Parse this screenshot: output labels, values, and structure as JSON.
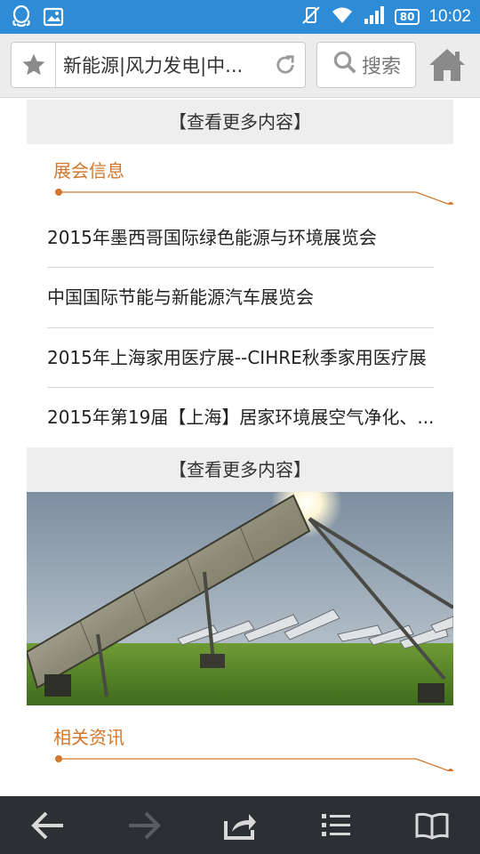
{
  "status_bar": {
    "time": "10:02",
    "battery": "80"
  },
  "browser": {
    "url_title": "新能源|风力发电|中...",
    "search_label": "搜索"
  },
  "content": {
    "more_label_1": "【查看更多内容】",
    "section_expo": "展会信息",
    "expo_items": [
      "2015年墨西哥国际绿色能源与环境展览会",
      "中国国际节能与新能源汽车展览会",
      "2015年上海家用医疗展--CIHRE秋季家用医疗展",
      "2015年第19届【上海】居家环境展空气净化、..."
    ],
    "more_label_2": "【查看更多内容】",
    "section_related": "相关资讯"
  },
  "colors": {
    "status_bar": "#2e8bd6",
    "accent": "#d2772b",
    "toolbar": "#2c2f33"
  }
}
